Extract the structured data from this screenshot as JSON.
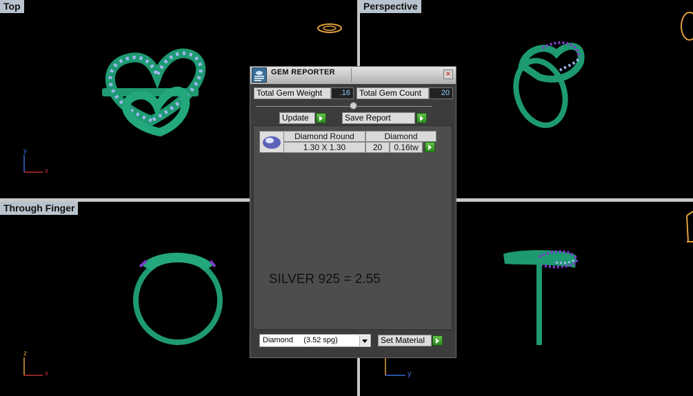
{
  "viewports": {
    "top": "Top",
    "perspective": "Perspective",
    "through_finger": "Through Finger"
  },
  "axes": {
    "top": {
      "v": "y",
      "h": "x"
    },
    "finger": {
      "v": "z",
      "h": "x"
    },
    "side": {
      "h": "y"
    }
  },
  "colors": {
    "ring_green": "#1e9a72",
    "gem_blue": "#9fb8ef",
    "gem_purple": "#7a3cc8",
    "viewport_label_bg": "#b9c3cd",
    "go_green": "#3aa82a"
  },
  "dialog": {
    "title": "GEM REPORTER",
    "close_icon": "close-icon",
    "total_gem_weight_label": "Total Gem Weight",
    "total_gem_weight": ".16",
    "total_gem_count_label": "Total Gem Count",
    "total_gem_count": "20",
    "update_label": "Update",
    "save_report_label": "Save Report",
    "table": {
      "headers": [
        "Diamond Round",
        "Diamond"
      ],
      "row": {
        "size": "1.30 X 1.30",
        "count": "20",
        "weight": "0.16tw"
      }
    },
    "material_note": "SILVER 925 = 2.55",
    "material_select": "Diamond     (3.52 spg)",
    "set_material_label": "Set Material"
  }
}
